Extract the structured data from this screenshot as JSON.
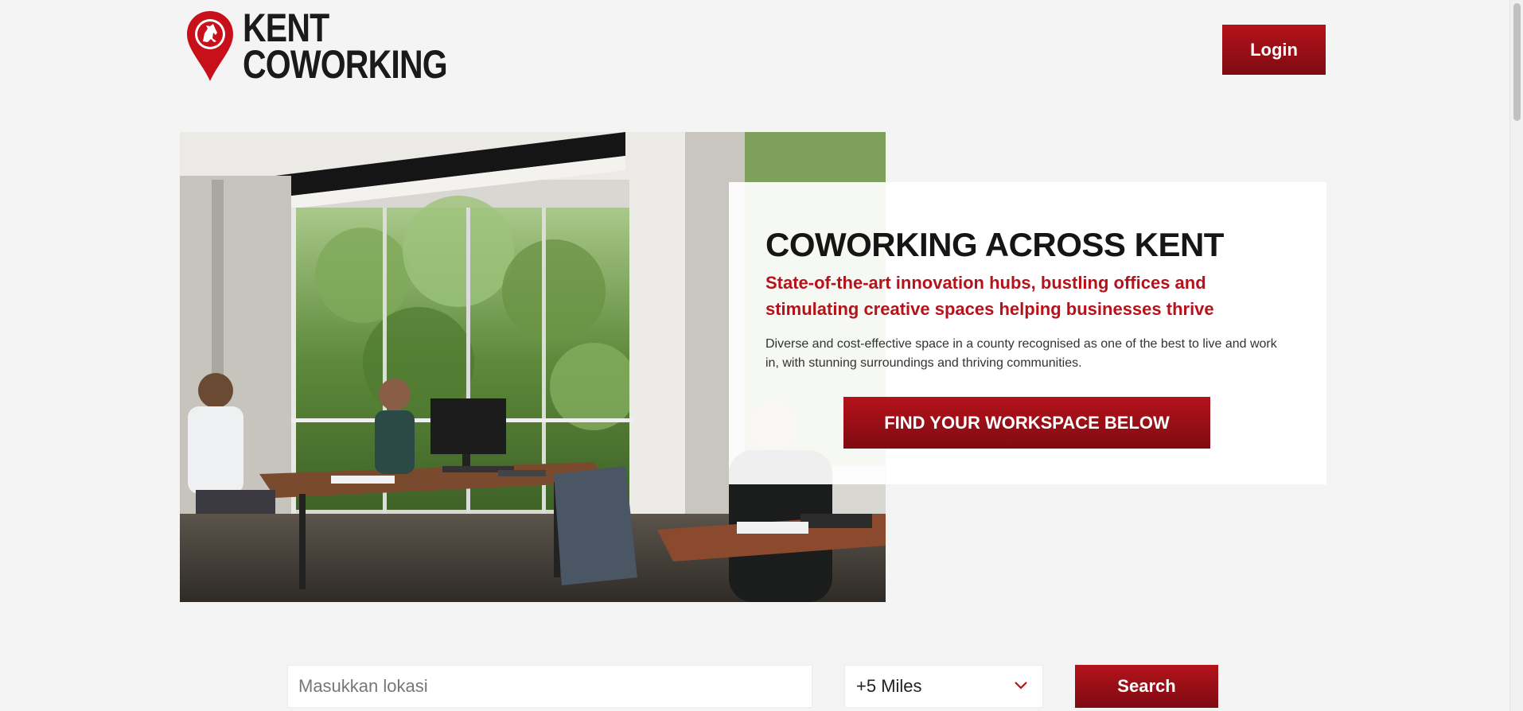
{
  "header": {
    "logo_line1": "KENT",
    "logo_line2": "COWORKING",
    "login_label": "Login"
  },
  "hero": {
    "title": "COWORKING ACROSS KENT",
    "subtitle": "State-of-the-art innovation hubs, bustling offices and stimulating creative spaces helping businesses thrive",
    "body": "Diverse and cost-effective space in a county recognised as one of the best to live and work in, with stunning surroundings and thriving communities.",
    "cta_label": "FIND YOUR WORKSPACE BELOW",
    "photo_icon": "office-photo"
  },
  "search": {
    "placeholder": "Masukkan lokasi",
    "radius_value": "+5 Miles",
    "button_label": "Search"
  },
  "colors": {
    "brand_red": "#b5121b",
    "brand_red_dark": "#7f0b12",
    "background": "#f4f4f4"
  }
}
